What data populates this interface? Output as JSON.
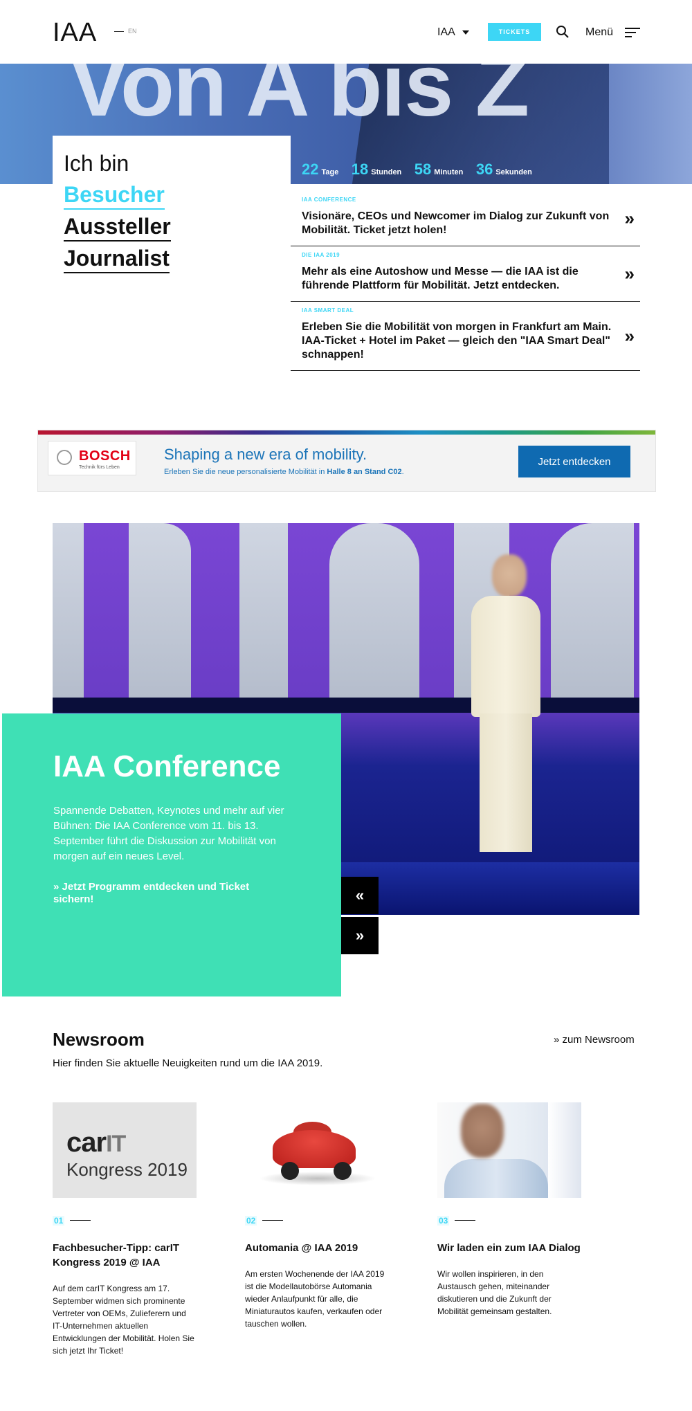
{
  "header": {
    "logo": "IAA",
    "lang": "EN",
    "nav_iaa": "IAA",
    "tickets": "TICKETS",
    "menu": "Menü"
  },
  "hero": {
    "big_text": "Von A bis Z",
    "iam_title": "Ich bin",
    "roles": [
      "Besucher",
      "Aussteller",
      "Journalist"
    ],
    "countdown": {
      "days": "22",
      "days_label": "Tage",
      "hours": "18",
      "hours_label": "Stunden",
      "minutes": "58",
      "minutes_label": "Minuten",
      "seconds": "36",
      "seconds_label": "Sekunden"
    }
  },
  "teasers": [
    {
      "category": "IAA CONFERENCE",
      "text": "Visionäre, CEOs und Newcomer im Dialog zur Zukunft von Mobilität. Ticket jetzt holen!"
    },
    {
      "category": "DIE IAA 2019",
      "text": "Mehr als eine Autoshow und Messe — die IAA ist die führende Plattform für Mobilität. Jetzt entdecken."
    },
    {
      "category": "IAA SMART DEAL",
      "text": "Erleben Sie die Mobilität von morgen in Frankfurt am Main. IAA-Ticket + Hotel im Paket — gleich den \"IAA Smart Deal\" schnappen!"
    }
  ],
  "bosch": {
    "brand": "BOSCH",
    "tagline": "Technik fürs Leben",
    "headline": "Shaping a new era of mobility.",
    "sub_prefix": "Erleben Sie die neue personalisierte Mobilität in ",
    "sub_bold": "Halle 8 an Stand C02",
    "sub_suffix": ".",
    "button": "Jetzt entdecken"
  },
  "conference": {
    "title": "IAA Conference",
    "description": "Spannende Debatten, Keynotes und mehr auf vier Bühnen: Die IAA Conference vom 11. bis 13. September führt die Diskussion zur Mobilität von morgen auf ein neues Level.",
    "cta": "» Jetzt Programm entdecken und Ticket sichern!",
    "prev": "«",
    "next": "»"
  },
  "newsroom": {
    "title": "Newsroom",
    "subtitle": "Hier finden Sie aktuelle Neuigkeiten rund um die IAA 2019.",
    "more": "» zum Newsroom",
    "cards": [
      {
        "num": "01",
        "image_text_top": "car",
        "image_text_top_b": "IT",
        "image_text_bottom": "Kongress 2019",
        "title": "Fachbesucher-Tipp: carIT Kongress 2019 @ IAA",
        "text": "Auf dem carIT Kongress am 17. September widmen sich prominente Vertreter von OEMs, Zulieferern und IT-Unternehmen aktuellen Entwicklungen der Mobilität. Holen Sie sich jetzt Ihr Ticket!"
      },
      {
        "num": "02",
        "title": "Automania @ IAA 2019",
        "text": "Am ersten Wochenende der IAA 2019 ist die Modellautobörse Automania wieder Anlaufpunkt für alle, die Miniaturautos kaufen, verkaufen oder tauschen wollen."
      },
      {
        "num": "03",
        "title": "Wir laden ein zum IAA Dialog",
        "text": "Wir wollen inspirieren, in den Austausch gehen, miteinander diskutieren und die Zukunft der Mobilität gemeinsam gestalten."
      }
    ]
  },
  "colors": {
    "accent_cyan": "#3dd6f5",
    "conference_green": "#3fe0b5",
    "bosch_blue": "#0f6ab1",
    "bosch_red": "#e20015"
  }
}
